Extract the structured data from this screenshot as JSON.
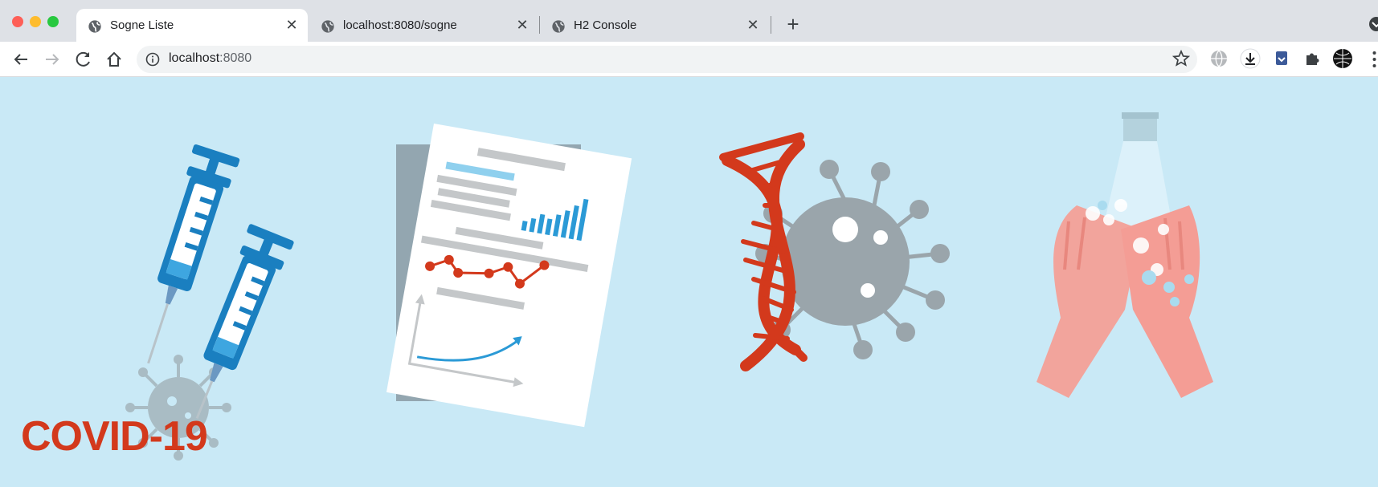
{
  "tabs": [
    {
      "title": "Sogne Liste",
      "active": true
    },
    {
      "title": "localhost:8080/sogne",
      "active": false
    },
    {
      "title": "H2 Console",
      "active": false
    }
  ],
  "address_bar": {
    "host": "localhost",
    "port": ":8080"
  },
  "banner": {
    "text": "COVID-19"
  },
  "colors": {
    "background": "#c9e9f6",
    "accent_red": "#d3391c",
    "syringe_blue": "#1a7fc0",
    "virus_grey": "#9aa5ab",
    "hand_pink": "#f2a49c"
  },
  "icons": [
    "globe-icon",
    "close-icon",
    "plus-icon",
    "back-icon",
    "forward-icon",
    "reload-icon",
    "home-icon",
    "info-icon",
    "star-icon",
    "download-icon",
    "puzzle-icon"
  ]
}
